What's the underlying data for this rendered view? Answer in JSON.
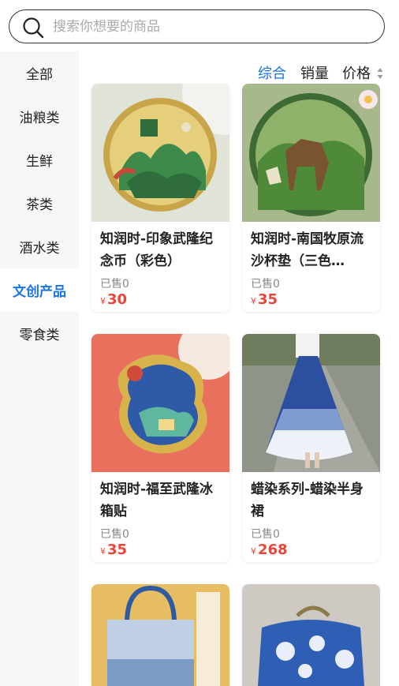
{
  "search": {
    "placeholder": "搜索你想要的商品"
  },
  "categories": [
    {
      "label": "全部"
    },
    {
      "label": "油粮类"
    },
    {
      "label": "生鲜"
    },
    {
      "label": "茶类"
    },
    {
      "label": "酒水类"
    },
    {
      "label": "文创产品"
    },
    {
      "label": "零食类"
    }
  ],
  "active_category": "文创产品",
  "sort": {
    "comprehensive": "综合",
    "sales": "销量",
    "price": "价格"
  },
  "products": [
    {
      "name": "知润时-印象武隆纪念币（彩色）",
      "sold": "已售0",
      "currency": "¥",
      "price": "30"
    },
    {
      "name": "知润时-南国牧原流沙杯垫（三色…",
      "sold": "已售0",
      "currency": "¥",
      "price": "35"
    },
    {
      "name": "知润时-福至武隆冰箱贴",
      "sold": "已售0",
      "currency": "¥",
      "price": "35"
    },
    {
      "name": "蜡染系列-蜡染半身裙",
      "sold": "已售0",
      "currency": "¥",
      "price": "268"
    }
  ],
  "colors": {
    "accent": "#1a73e8",
    "price": "#e8463a"
  }
}
